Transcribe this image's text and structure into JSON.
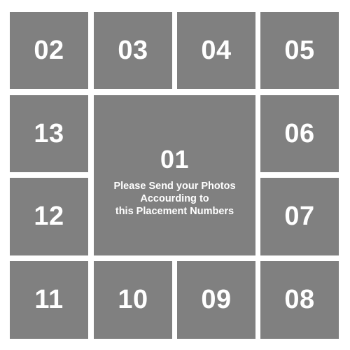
{
  "tiles": {
    "t01": "01",
    "t02": "02",
    "t03": "03",
    "t04": "04",
    "t05": "05",
    "t06": "06",
    "t07": "07",
    "t08": "08",
    "t09": "09",
    "t10": "10",
    "t11": "11",
    "t12": "12",
    "t13": "13"
  },
  "caption": {
    "line1": "Please Send your Photos",
    "line2": "Accourding to",
    "line3": "this Placement Numbers"
  },
  "colors": {
    "tile": "#808080",
    "text": "#ffffff",
    "background": "#ffffff"
  }
}
